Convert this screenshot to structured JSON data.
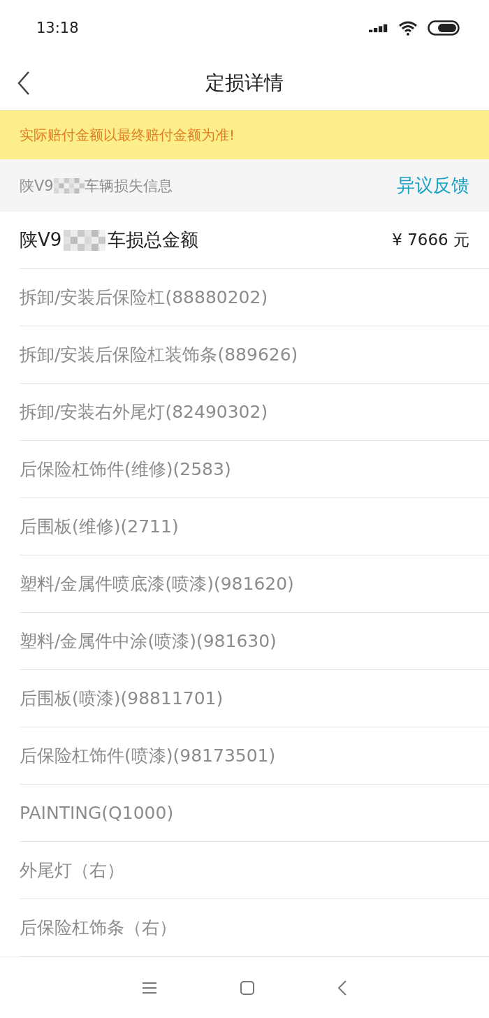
{
  "status_bar": {
    "time": "13:18"
  },
  "header": {
    "title": "定损详情"
  },
  "notice": "实际赔付金额以最终赔付金额为准!",
  "section": {
    "plate_prefix": "陕V9",
    "title_suffix": "车辆损失信息",
    "action": "异议反馈"
  },
  "total": {
    "plate_prefix": "陕V9",
    "label_suffix": "车损总金额",
    "amount": "¥ 7666 元"
  },
  "items": [
    {
      "name": "拆卸/安装后保险杠(88880202)"
    },
    {
      "name": "拆卸/安装后保险杠装饰条(889626)"
    },
    {
      "name": "拆卸/安装右外尾灯(82490302)"
    },
    {
      "name": "后保险杠饰件(维修)(2583)"
    },
    {
      "name": "后围板(维修)(2711)"
    },
    {
      "name": "塑料/金属件喷底漆(喷漆)(981620)"
    },
    {
      "name": "塑料/金属件中涂(喷漆)(981630)"
    },
    {
      "name": "后围板(喷漆)(98811701)"
    },
    {
      "name": "后保险杠饰件(喷漆)(98173501)"
    },
    {
      "name": "PAINTING(Q1000)"
    },
    {
      "name": "外尾灯（右）"
    },
    {
      "name": "后保险杠饰条（右）"
    }
  ]
}
